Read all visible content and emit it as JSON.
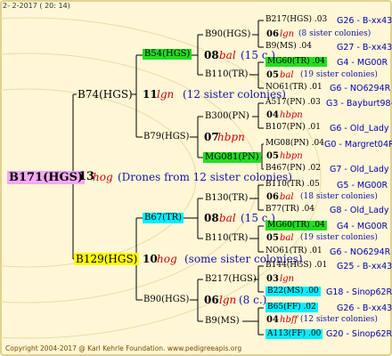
{
  "header": "2-  2-2017 ( 20: 14)",
  "footer": "Copyright 2004-2017 @ Karl Kehrle Foundation.   www.pedigreeapis.org",
  "root": {
    "id": "B171(HGS)",
    "gen_num": "13",
    "gen_race": "hog",
    "gen_note": "(Drones from 12 sister colonies)"
  },
  "g1": [
    {
      "id": "B74(HGS)",
      "gen_num": "11",
      "gen_race": "lgn",
      "gen_note": "(12 sister colonies)"
    },
    {
      "id": "B129(HGS)",
      "gen_num": "10",
      "gen_race": "hog",
      "gen_note": "(some sister colonies)"
    }
  ],
  "g2": [
    {
      "id": "B54(HGS)",
      "gen_num": "08",
      "gen_race": "bal",
      "gen_note": "(15 c.)"
    },
    {
      "id": "B79(HGS)",
      "gen_num": "07",
      "gen_race": "hbpn",
      "gen_note": ""
    },
    {
      "id": "B67(TR)",
      "gen_num": "08",
      "gen_race": "bal",
      "gen_note": "(15 c.)"
    },
    {
      "id": "B90(HGS)",
      "gen_num": "06",
      "gen_race": "lgn",
      "gen_note": "(8 c.)"
    }
  ],
  "g3": [
    {
      "id": "B90(HGS)",
      "gen_num": "06",
      "gen_race": "lgn",
      "gen_note": "(8 sister colonies)"
    },
    {
      "id": "B110(TR)",
      "gen_num": "05",
      "gen_race": "bal",
      "gen_note": "(19 sister colonies)"
    },
    {
      "id": "B300(PN)",
      "gen_num": "04",
      "gen_race": "hbpn",
      "gen_note": ""
    },
    {
      "id": "MG081(PN)",
      "gen_num": "05",
      "gen_race": "hbpn",
      "gen_note": ""
    },
    {
      "id": "B130(TR)",
      "gen_num": "06",
      "gen_race": "bal",
      "gen_note": "(18 sister colonies)"
    },
    {
      "id": "B110(TR)",
      "gen_num": "05",
      "gen_race": "bal",
      "gen_note": "(19 sister colonies)"
    },
    {
      "id": "B217(HGS)",
      "gen_num": "03",
      "gen_race": "lgn",
      "gen_note": ""
    },
    {
      "id": "B9(MS)",
      "gen_num": "04",
      "gen_race": "hbff",
      "gen_note": "(12 sister colonies)"
    }
  ],
  "g4": [
    {
      "id": "B217(HGS) .03",
      "ref": "G26 - B-xx43"
    },
    {
      "id": "B9(MS) .04",
      "ref": "G27 - B-xx43"
    },
    {
      "id": "MG60(TR) .04",
      "ref": "G4 - MG00R"
    },
    {
      "id": "NO61(TR) .01",
      "ref": "G6 - NO6294R"
    },
    {
      "id": "A517(PN) .03",
      "ref": "G3 - Bayburt98-3"
    },
    {
      "id": "B107(PN) .01",
      "ref": "G6 - Old_Lady"
    },
    {
      "id": "MG08(PN) .04",
      "ref": "G0 - Margret04R"
    },
    {
      "id": "B467(PN) .02",
      "ref": "G7 - Old_Lady"
    },
    {
      "id": "B110(TR) .05",
      "ref": "G5 - MG00R"
    },
    {
      "id": "B77(TR) .04",
      "ref": "G8 - Old_Lady"
    },
    {
      "id": "MG60(TR) .04",
      "ref": "G4 - MG00R"
    },
    {
      "id": "NO61(TR) .01",
      "ref": "G6 - NO6294R"
    },
    {
      "id": "B144(HGS) .01",
      "ref": "G25 - B-xx43"
    },
    {
      "id": "B22(MS) .00",
      "ref": "G18 - Sinop62R"
    },
    {
      "id": "B65(FF) .02",
      "ref": "G26 - B-xx43"
    },
    {
      "id": "A113(FF) .00",
      "ref": "G20 - Sinop62R"
    }
  ]
}
